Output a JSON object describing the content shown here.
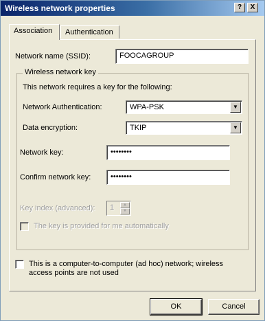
{
  "window": {
    "title": "Wireless network properties",
    "help_button": "?",
    "close_button": "X"
  },
  "tabs": [
    {
      "label": "Association",
      "active": true
    },
    {
      "label": "Authentication",
      "active": false
    }
  ],
  "ssid": {
    "label": "Network name (SSID):",
    "value": "FOOCAGROUP"
  },
  "key_group": {
    "title": "Wireless network key",
    "description": "This network requires a key for the following:",
    "auth_label": "Network Authentication:",
    "auth_value": "WPA-PSK",
    "enc_label": "Data encryption:",
    "enc_value": "TKIP",
    "key_label": "Network key:",
    "key_value": "••••••••",
    "confirm_label": "Confirm network key:",
    "confirm_value": "••••••••",
    "index_label": "Key index (advanced):",
    "index_value": "1",
    "auto_key_label": "The key is provided for me automatically",
    "auto_key_checked": false
  },
  "adhoc": {
    "label_line1": "This is a computer-to-computer (ad hoc) network; wireless",
    "label_line2": "access points are not used",
    "checked": false
  },
  "buttons": {
    "ok": "OK",
    "cancel": "Cancel"
  }
}
